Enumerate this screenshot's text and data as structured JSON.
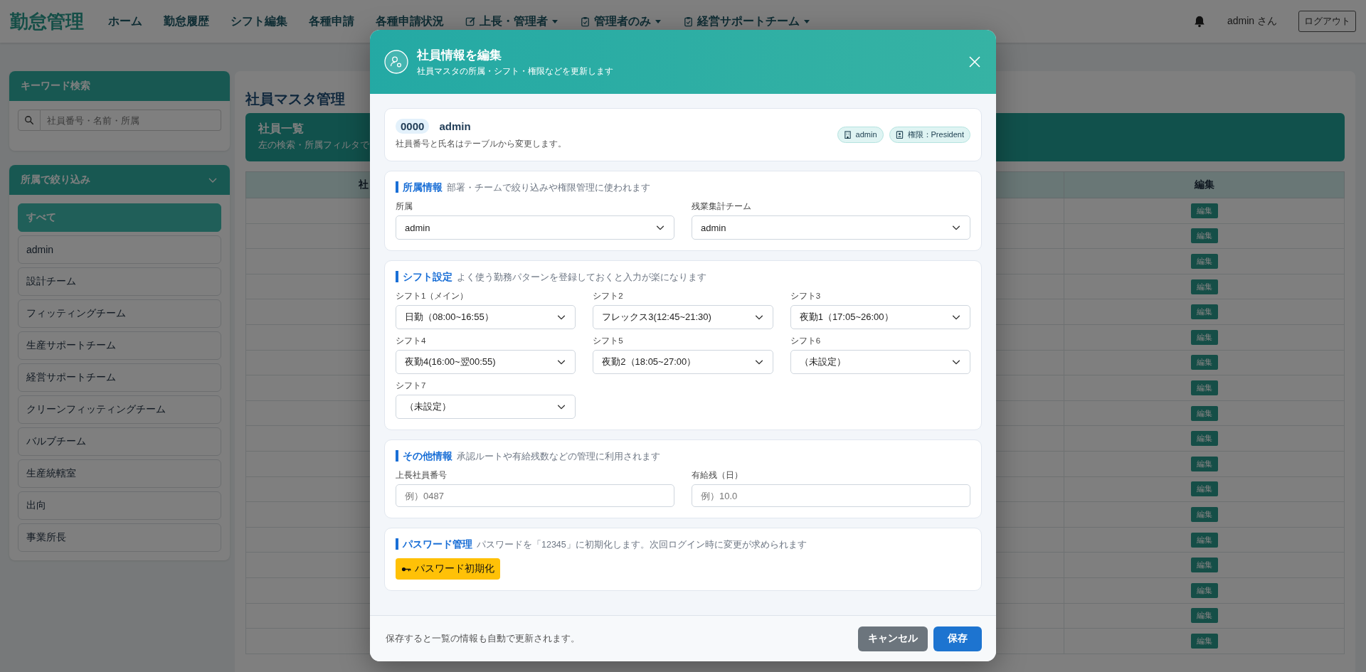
{
  "nav": {
    "logo": "勤怠管理",
    "items": [
      {
        "label": "ホーム",
        "kind": "link"
      },
      {
        "label": "勤怠履歴",
        "kind": "link"
      },
      {
        "label": "シフト編集",
        "kind": "link"
      },
      {
        "label": "各種申請",
        "kind": "link"
      },
      {
        "label": "各種申請状況",
        "kind": "link"
      },
      {
        "label": "上長・管理者",
        "kind": "dropdown"
      },
      {
        "label": "管理者のみ",
        "kind": "dropdown"
      },
      {
        "label": "経営サポートチーム",
        "kind": "dropdown"
      }
    ],
    "user": "admin さん",
    "logout": "ログアウト"
  },
  "sidebar": {
    "search": {
      "title": "キーワード検索",
      "placeholder": "社員番号・名前・所属"
    },
    "filter": {
      "title": "所属で絞り込み",
      "expanded": true,
      "items": [
        {
          "label": "すべて",
          "selected": true
        },
        {
          "label": "admin",
          "selected": false
        },
        {
          "label": "設計チーム",
          "selected": false
        },
        {
          "label": "フィッティングチーム",
          "selected": false
        },
        {
          "label": "生産サポートチーム",
          "selected": false
        },
        {
          "label": "経営サポートチーム",
          "selected": false
        },
        {
          "label": "クリーンフィッティングチーム",
          "selected": false
        },
        {
          "label": "バルブチーム",
          "selected": false
        },
        {
          "label": "生産統轄室",
          "selected": false
        },
        {
          "label": "出向",
          "selected": false
        },
        {
          "label": "事業所長",
          "selected": false
        }
      ]
    }
  },
  "main": {
    "title": "社員マスタ管理",
    "banner": {
      "title": "社員一覧",
      "subtitle": "左の検索・所属フィルタで"
    },
    "table": {
      "column_1_header": "社",
      "column_4_header": "編集",
      "rows": [
        {
          "edit": "編集"
        },
        {
          "edit": "編集"
        },
        {
          "edit": "編集"
        },
        {
          "edit": "編集"
        },
        {
          "edit": "編集"
        },
        {
          "edit": "編集"
        },
        {
          "edit": "編集"
        },
        {
          "edit": "編集"
        },
        {
          "edit": "編集"
        },
        {
          "edit": "編集"
        },
        {
          "edit": "編集"
        },
        {
          "edit": "編集"
        },
        {
          "edit": "編集"
        },
        {
          "edit": "編集"
        },
        {
          "edit": "編集"
        },
        {
          "edit": "編集"
        },
        {
          "edit": "編集"
        },
        {
          "edit": "編集"
        }
      ]
    }
  },
  "modal": {
    "title": "社員情報を編集",
    "subtitle": "社員マスタの所属・シフト・権限などを更新します",
    "employee": {
      "number": "0000",
      "name": "admin",
      "note": "社員番号と氏名はテーブルから変更します。",
      "badges": [
        {
          "kind": "department",
          "label": "admin"
        },
        {
          "kind": "role",
          "label": "権限：President"
        }
      ]
    },
    "sections": [
      {
        "kind": "selects",
        "title": "所属情報",
        "description": "部署・チームで絞り込みや権限管理に使われます",
        "fields": [
          {
            "label": "所属",
            "value": "admin"
          },
          {
            "label": "残業集計チーム",
            "value": "admin"
          }
        ]
      },
      {
        "kind": "selects",
        "title": "シフト設定",
        "description": "よく使う勤務パターンを登録しておくと入力が楽になります",
        "fields": [
          {
            "label": "シフト1（メイン）",
            "value": "日勤（08:00~16:55）"
          },
          {
            "label": "シフト2",
            "value": "フレックス3(12:45~21:30)"
          },
          {
            "label": "シフト3",
            "value": "夜勤1（17:05~26:00）"
          },
          {
            "label": "シフト4",
            "value": "夜勤4(16:00~翌00:55)"
          },
          {
            "label": "シフト5",
            "value": "夜勤2（18:05~27:00）"
          },
          {
            "label": "シフト6",
            "value": "（未設定）"
          },
          {
            "label": "シフト7",
            "value": "（未設定）"
          }
        ]
      },
      {
        "kind": "inputs",
        "title": "その他情報",
        "description": "承認ルートや有給残数などの管理に利用されます",
        "fields": [
          {
            "label": "上長社員番号",
            "placeholder": "例）0487"
          },
          {
            "label": "有給残（日）",
            "placeholder": "例）10.0"
          }
        ]
      },
      {
        "kind": "action",
        "title": "パスワード管理",
        "description": "パスワードを「12345」に初期化します。次回ログイン時に変更が求められます",
        "button": "パスワード初期化"
      }
    ],
    "footer": {
      "note": "保存すると一覧の情報も自動で更新されます。",
      "cancel": "キャンセル",
      "save": "保存"
    }
  }
}
